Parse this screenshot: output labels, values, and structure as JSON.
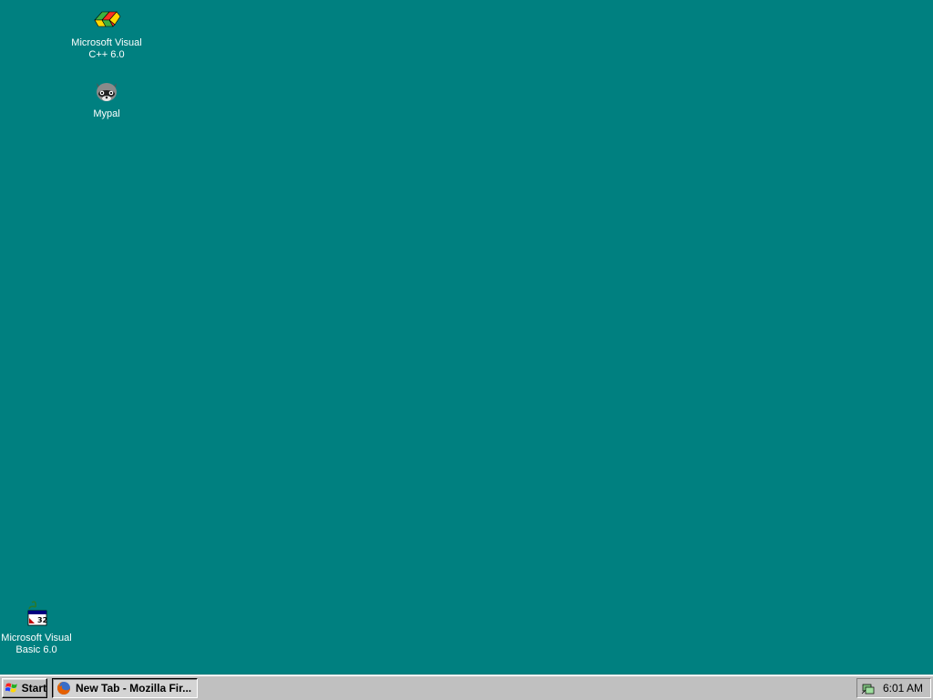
{
  "desktop": {
    "background_color": "#008080",
    "icons": [
      {
        "label": "Microsoft Visual\nC++ 6.0",
        "icon": "visual-cpp-icon"
      },
      {
        "label": "Mypal",
        "icon": "mypal-raccoon-icon"
      },
      {
        "label": "Microsoft Visual\nBasic 6.0",
        "icon": "visual-basic-icon"
      }
    ]
  },
  "taskbar": {
    "start_label": "Start",
    "tasks": [
      {
        "label": "New Tab - Mozilla Fir...",
        "icon": "firefox-icon"
      }
    ],
    "tray": {
      "icons": [
        "network-tray-icon"
      ],
      "clock": "6:01 AM"
    }
  }
}
